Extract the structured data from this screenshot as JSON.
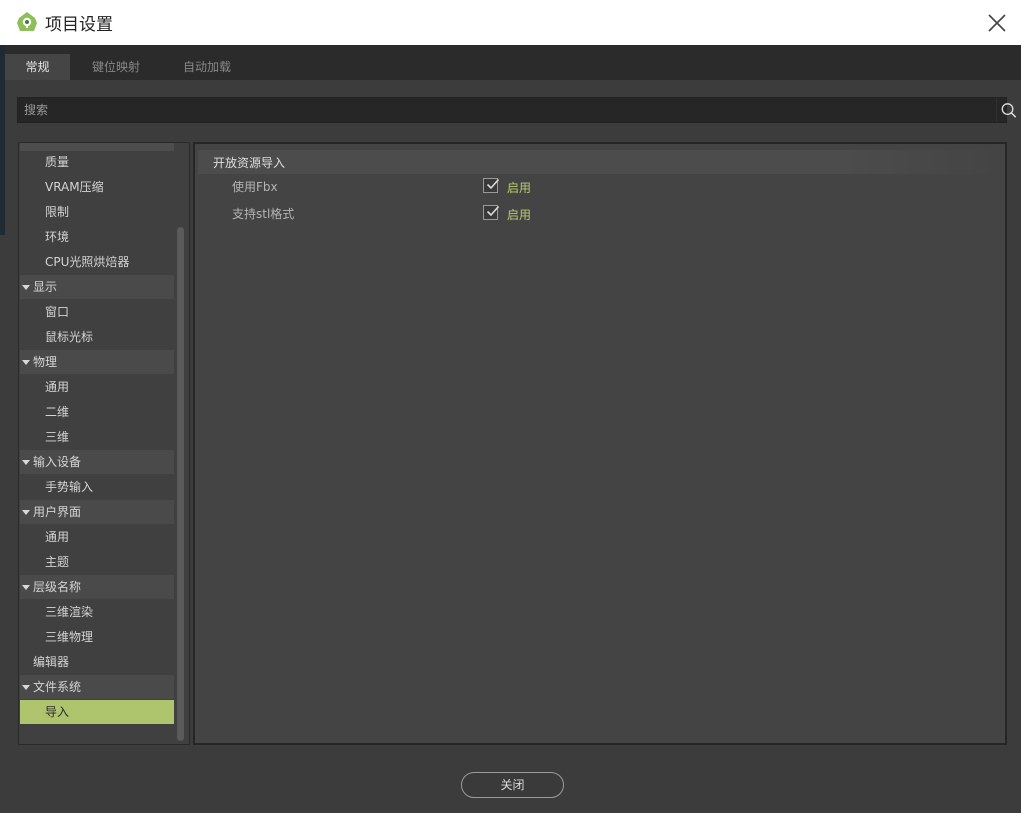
{
  "window": {
    "title": "项目设置"
  },
  "tabs": [
    {
      "label": "常规",
      "active": true
    },
    {
      "label": "键位映射",
      "active": false
    },
    {
      "label": "自动加载",
      "active": false
    }
  ],
  "search": {
    "placeholder": "搜索"
  },
  "tree": {
    "items": [
      {
        "label": "质量",
        "kind": "child"
      },
      {
        "label": "VRAM压缩",
        "kind": "child"
      },
      {
        "label": "限制",
        "kind": "child"
      },
      {
        "label": "环境",
        "kind": "child"
      },
      {
        "label": "CPU光照烘焙器",
        "kind": "child"
      },
      {
        "label": "显示",
        "kind": "section"
      },
      {
        "label": "窗口",
        "kind": "child"
      },
      {
        "label": "鼠标光标",
        "kind": "child"
      },
      {
        "label": "物理",
        "kind": "section"
      },
      {
        "label": "通用",
        "kind": "child"
      },
      {
        "label": "二维",
        "kind": "child"
      },
      {
        "label": "三维",
        "kind": "child"
      },
      {
        "label": "输入设备",
        "kind": "section"
      },
      {
        "label": "手势输入",
        "kind": "child"
      },
      {
        "label": "用户界面",
        "kind": "section"
      },
      {
        "label": "通用",
        "kind": "child"
      },
      {
        "label": "主题",
        "kind": "child"
      },
      {
        "label": "层级名称",
        "kind": "section"
      },
      {
        "label": "三维渲染",
        "kind": "child"
      },
      {
        "label": "三维物理",
        "kind": "child"
      },
      {
        "label": "编辑器",
        "kind": "plain"
      },
      {
        "label": "文件系统",
        "kind": "section"
      },
      {
        "label": "导入",
        "kind": "child",
        "selected": true
      }
    ]
  },
  "panel": {
    "section_title": "开放资源导入",
    "properties": [
      {
        "label": "使用Fbx",
        "checked": true,
        "value_text": "启用"
      },
      {
        "label": "支持stl格式",
        "checked": true,
        "value_text": "启用"
      }
    ]
  },
  "footer": {
    "close_label": "关闭"
  },
  "colors": {
    "accent": "#aec56e",
    "check_text": "#b6cc6e"
  },
  "icons": {
    "app": "godot-logo-icon",
    "close": "close-icon",
    "search": "search-icon",
    "check": "check-icon",
    "caret": "caret-down-icon"
  }
}
